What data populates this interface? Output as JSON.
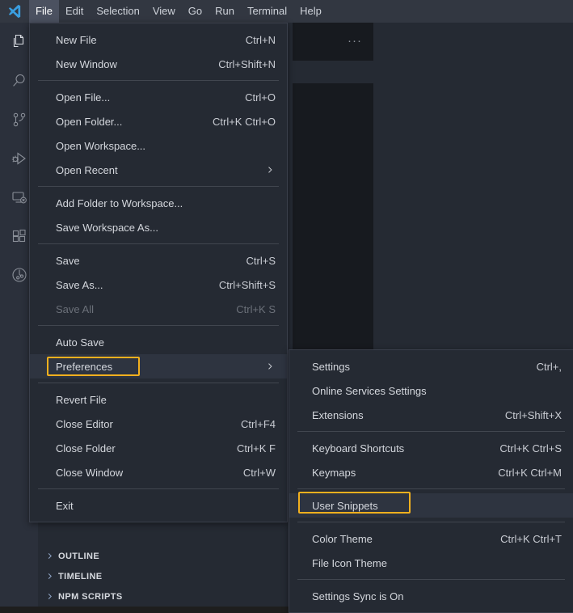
{
  "app": {
    "logo_icon": "vscode-logo-icon",
    "accent_highlight": "#f2b01e",
    "menu_bg": "#252a33",
    "titlebar_bg": "#323741"
  },
  "menubar": {
    "items": [
      {
        "label": "File",
        "active": true
      },
      {
        "label": "Edit",
        "active": false
      },
      {
        "label": "Selection",
        "active": false
      },
      {
        "label": "View",
        "active": false
      },
      {
        "label": "Go",
        "active": false
      },
      {
        "label": "Run",
        "active": false
      },
      {
        "label": "Terminal",
        "active": false
      },
      {
        "label": "Help",
        "active": false
      }
    ]
  },
  "activitybar": {
    "items": [
      {
        "name": "explorer-icon",
        "label": "Explorer",
        "active": true
      },
      {
        "name": "search-icon",
        "label": "Search",
        "active": false
      },
      {
        "name": "source-control-icon",
        "label": "Source Control",
        "active": false
      },
      {
        "name": "run-and-debug-icon",
        "label": "Run and Debug",
        "active": false
      },
      {
        "name": "remote-explorer-icon",
        "label": "Remote Explorer",
        "active": false
      },
      {
        "name": "extensions-icon",
        "label": "Extensions",
        "active": false
      },
      {
        "name": "testing-icon",
        "label": "Testing",
        "active": false
      }
    ]
  },
  "sidebar": {
    "sections": [
      {
        "label": "OUTLINE",
        "expanded": false
      },
      {
        "label": "TIMELINE",
        "expanded": false
      },
      {
        "label": "NPM SCRIPTS",
        "expanded": false
      }
    ]
  },
  "editor": {
    "tab_overflow_label": "···"
  },
  "file_menu": {
    "rows": [
      {
        "type": "item",
        "label": "New File",
        "key": "Ctrl+N"
      },
      {
        "type": "item",
        "label": "New Window",
        "key": "Ctrl+Shift+N"
      },
      {
        "type": "separator"
      },
      {
        "type": "item",
        "label": "Open File...",
        "key": "Ctrl+O"
      },
      {
        "type": "item",
        "label": "Open Folder...",
        "key": "Ctrl+K Ctrl+O"
      },
      {
        "type": "item",
        "label": "Open Workspace...",
        "key": ""
      },
      {
        "type": "item",
        "label": "Open Recent",
        "key": "",
        "submenu": true
      },
      {
        "type": "separator"
      },
      {
        "type": "item",
        "label": "Add Folder to Workspace...",
        "key": ""
      },
      {
        "type": "item",
        "label": "Save Workspace As...",
        "key": ""
      },
      {
        "type": "separator"
      },
      {
        "type": "item",
        "label": "Save",
        "key": "Ctrl+S"
      },
      {
        "type": "item",
        "label": "Save As...",
        "key": "Ctrl+Shift+S"
      },
      {
        "type": "item",
        "label": "Save All",
        "key": "Ctrl+K S",
        "disabled": true
      },
      {
        "type": "separator"
      },
      {
        "type": "item",
        "label": "Auto Save",
        "key": ""
      },
      {
        "type": "item",
        "label": "Preferences",
        "key": "",
        "submenu": true,
        "selected": true,
        "highlighted": true
      },
      {
        "type": "separator"
      },
      {
        "type": "item",
        "label": "Revert File",
        "key": ""
      },
      {
        "type": "item",
        "label": "Close Editor",
        "key": "Ctrl+F4"
      },
      {
        "type": "item",
        "label": "Close Folder",
        "key": "Ctrl+K F"
      },
      {
        "type": "item",
        "label": "Close Window",
        "key": "Ctrl+W"
      },
      {
        "type": "separator"
      },
      {
        "type": "item",
        "label": "Exit",
        "key": ""
      }
    ]
  },
  "preferences_submenu": {
    "rows": [
      {
        "type": "item",
        "label": "Settings",
        "key": "Ctrl+,"
      },
      {
        "type": "item",
        "label": "Online Services Settings",
        "key": ""
      },
      {
        "type": "item",
        "label": "Extensions",
        "key": "Ctrl+Shift+X"
      },
      {
        "type": "separator"
      },
      {
        "type": "item",
        "label": "Keyboard Shortcuts",
        "key": "Ctrl+K Ctrl+S"
      },
      {
        "type": "item",
        "label": "Keymaps",
        "key": "Ctrl+K Ctrl+M"
      },
      {
        "type": "separator"
      },
      {
        "type": "item",
        "label": "User Snippets",
        "key": "",
        "selected": true,
        "highlighted": true
      },
      {
        "type": "separator"
      },
      {
        "type": "item",
        "label": "Color Theme",
        "key": "Ctrl+K Ctrl+T"
      },
      {
        "type": "item",
        "label": "File Icon Theme",
        "key": ""
      },
      {
        "type": "separator"
      },
      {
        "type": "item",
        "label": "Settings Sync is On",
        "key": ""
      }
    ]
  }
}
